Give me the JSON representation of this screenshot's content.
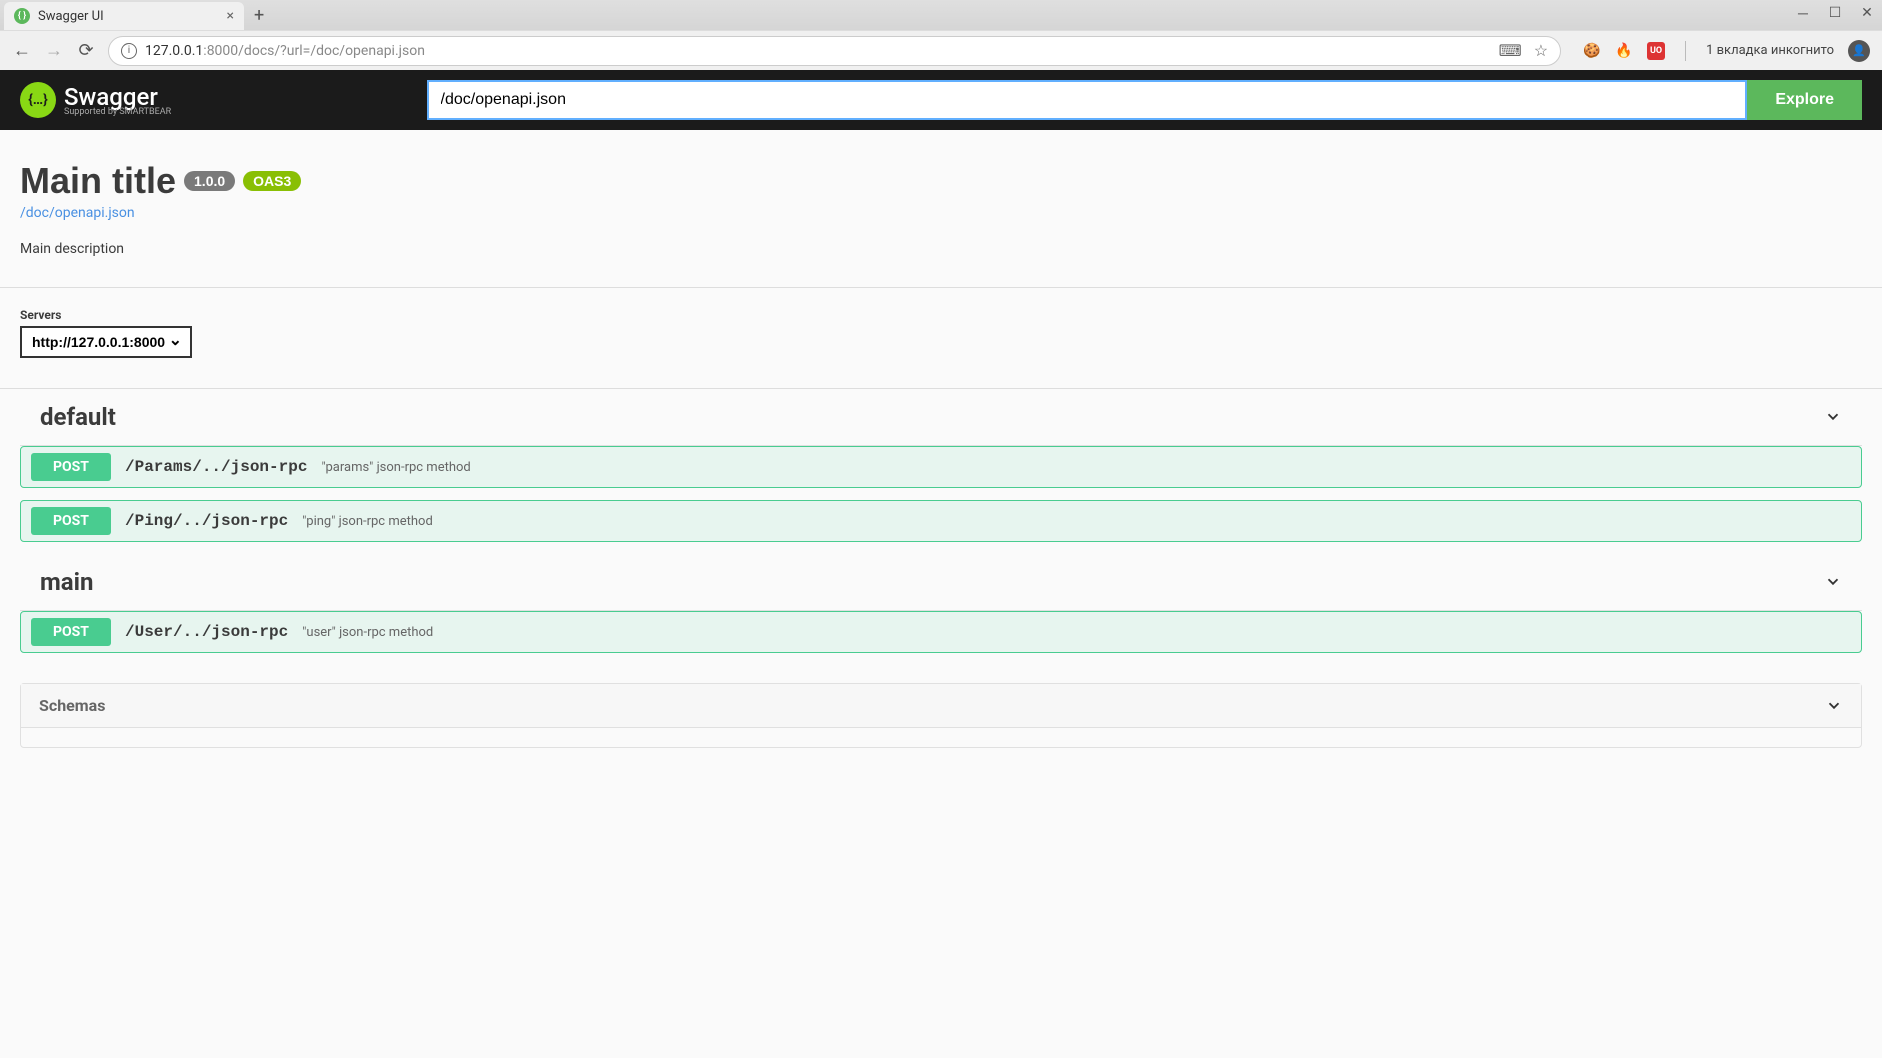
{
  "browser": {
    "tab_title": "Swagger UI",
    "url_host": "127.0.0.1",
    "url_port_path": ":8000/docs/?url=/doc/openapi.json",
    "incognito_label": "1 вкладка инкогнито"
  },
  "topbar": {
    "logo_text": "Swagger",
    "logo_sub": "Supported by SMARTBEAR",
    "url_input_value": "/doc/openapi.json",
    "explore_label": "Explore"
  },
  "api": {
    "title": "Main title",
    "version": "1.0.0",
    "oas_badge": "OAS3",
    "spec_link": "/doc/openapi.json",
    "description": "Main description"
  },
  "servers": {
    "label": "Servers",
    "selected": "http://127.0.0.1:8000"
  },
  "tags": [
    {
      "name": "default",
      "operations": [
        {
          "method": "POST",
          "path": "/Params/../json-rpc",
          "summary": "\"params\" json-rpc method"
        },
        {
          "method": "POST",
          "path": "/Ping/../json-rpc",
          "summary": "\"ping\" json-rpc method"
        }
      ]
    },
    {
      "name": "main",
      "operations": [
        {
          "method": "POST",
          "path": "/User/../json-rpc",
          "summary": "\"user\" json-rpc method"
        }
      ]
    }
  ],
  "schemas": {
    "title": "Schemas"
  }
}
